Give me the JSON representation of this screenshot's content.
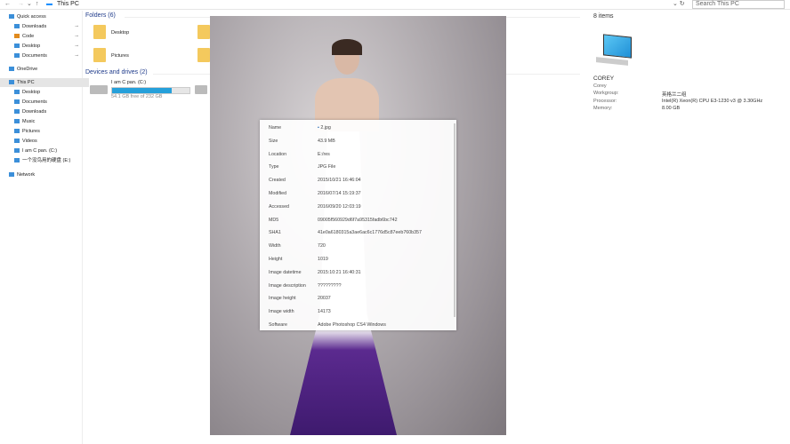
{
  "nav": {
    "breadcrumb": "This PC",
    "search_placeholder": "Search This PC"
  },
  "sidebar": {
    "items": [
      {
        "label": "Quick access",
        "icon": "star-icon"
      },
      {
        "label": "Downloads",
        "icon": "download-icon",
        "pinned": true
      },
      {
        "label": "Code",
        "icon": "folder-icon",
        "pinned": true
      },
      {
        "label": "Desktop",
        "icon": "desktop-icon",
        "pinned": true
      },
      {
        "label": "Documents",
        "icon": "document-icon",
        "pinned": true
      },
      {
        "label": "OneDrive",
        "icon": "cloud-icon"
      },
      {
        "label": "This PC",
        "icon": "computer-icon",
        "selected": true
      },
      {
        "label": "Desktop",
        "icon": "desktop-icon"
      },
      {
        "label": "Documents",
        "icon": "document-icon"
      },
      {
        "label": "Downloads",
        "icon": "download-icon"
      },
      {
        "label": "Music",
        "icon": "music-icon"
      },
      {
        "label": "Pictures",
        "icon": "pictures-icon"
      },
      {
        "label": "Videos",
        "icon": "video-icon"
      },
      {
        "label": "I am C pan. (C:)",
        "icon": "drive-icon"
      },
      {
        "label": "一个没鸟用的硬盘 (E:)",
        "icon": "drive-icon"
      },
      {
        "label": "Network",
        "icon": "network-icon"
      }
    ]
  },
  "main": {
    "folders_header": "Folders (6)",
    "folders": [
      "Desktop",
      "Pictures"
    ],
    "drives_header": "Devices and drives (2)",
    "drive": {
      "name": "I am C pan. (C:)",
      "free": "54.1 GB free of 232 GB",
      "used_fraction": 0.77
    }
  },
  "details": {
    "count": "8 items",
    "computer": "COREY",
    "user": "Corey",
    "props": [
      {
        "k": "Workgroup:",
        "v": "英格兰二组"
      },
      {
        "k": "Processor:",
        "v": "Intel(R) Xeon(R) CPU E3-1230 v3 @ 3.30GHz"
      },
      {
        "k": "Memory:",
        "v": "8.00 GB"
      }
    ]
  },
  "info": [
    {
      "k": "Name",
      "v": "2.jpg"
    },
    {
      "k": "Size",
      "v": "43.9 MB"
    },
    {
      "k": "Location",
      "v": "E:/res"
    },
    {
      "k": "Type",
      "v": "JPG File"
    },
    {
      "k": "Created",
      "v": "2015/10/21 16:46:04"
    },
    {
      "k": "Modified",
      "v": "2016/07/14 15:19:37"
    },
    {
      "k": "Accessed",
      "v": "2016/09/20 12:03:19"
    },
    {
      "k": "MD5",
      "v": "09005f560929d6f7a95315fadb6bc742"
    },
    {
      "k": "SHA1",
      "v": "41e0a6180315a3ae6ac6c1776d5c87eeb760b357"
    },
    {
      "k": "Width",
      "v": "720"
    },
    {
      "k": "Height",
      "v": "1019"
    },
    {
      "k": "Image datetime",
      "v": "2015:10:21 16:40:31"
    },
    {
      "k": "Image description",
      "v": "?????????"
    },
    {
      "k": "Image height",
      "v": "20037"
    },
    {
      "k": "Image width",
      "v": "14173"
    },
    {
      "k": "Software",
      "v": "Adobe Photoshop CS4 Windows"
    }
  ]
}
